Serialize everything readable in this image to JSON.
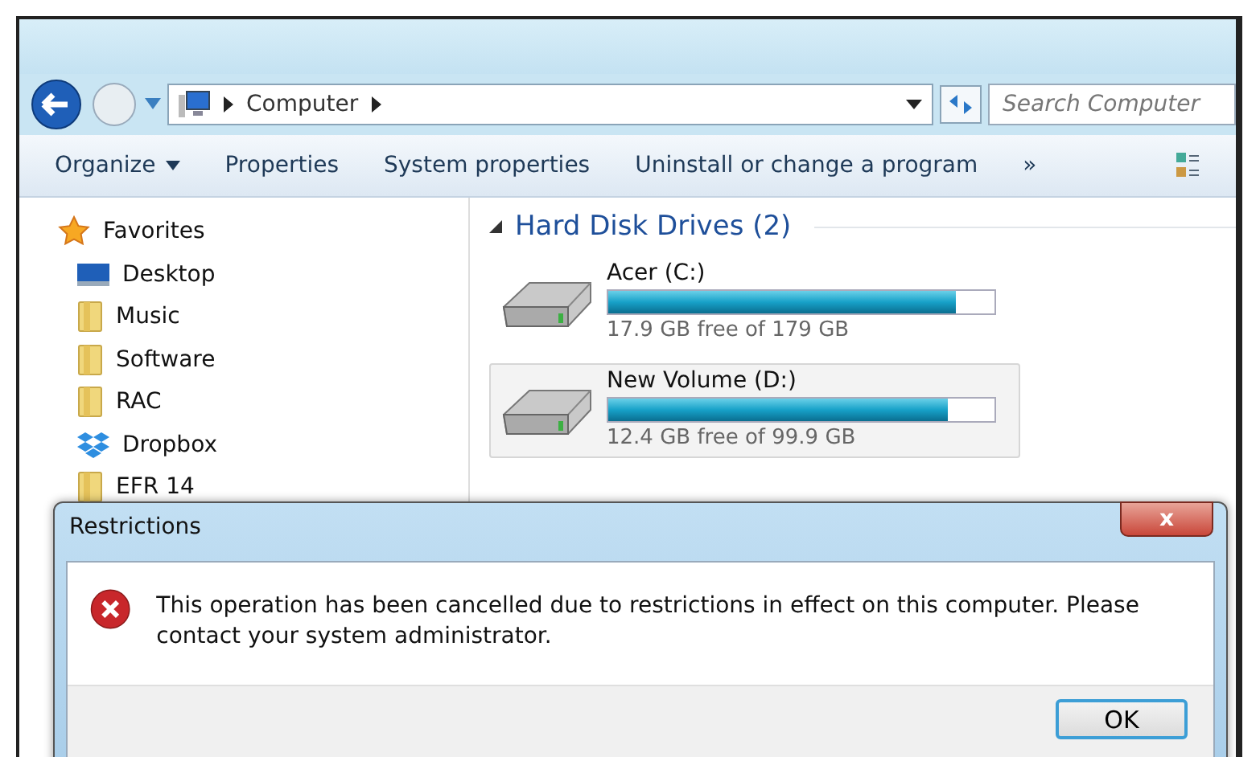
{
  "address_bar": {
    "segments": [
      "Computer"
    ]
  },
  "search": {
    "placeholder": "Search Computer"
  },
  "toolbar": {
    "items": [
      "Organize",
      "Properties",
      "System properties",
      "Uninstall or change a program"
    ],
    "more": "»"
  },
  "sidebar": {
    "items": [
      {
        "label": "Favorites",
        "kind": "star"
      },
      {
        "label": "Desktop",
        "kind": "desktop"
      },
      {
        "label": "Music",
        "kind": "folder"
      },
      {
        "label": "Software",
        "kind": "folder"
      },
      {
        "label": "RAC",
        "kind": "folder"
      },
      {
        "label": "Dropbox",
        "kind": "dropbox"
      },
      {
        "label": "EFR 14",
        "kind": "folder"
      }
    ]
  },
  "section": {
    "title": "Hard Disk Drives (2)",
    "expanded": true
  },
  "drives": [
    {
      "name": "Acer (C:)",
      "level": 0.9,
      "free": "17.9 GB free of 179 GB",
      "selected": false
    },
    {
      "name": "New Volume (D:)",
      "level": 0.88,
      "free": "12.4 GB free of 99.9 GB",
      "selected": true
    }
  ],
  "dialog": {
    "title": "Restrictions",
    "close": "x",
    "message": "This operation has been cancelled due to restrictions in effect on this computer. Please contact your system administrator.",
    "buttons": [
      "OK"
    ]
  }
}
